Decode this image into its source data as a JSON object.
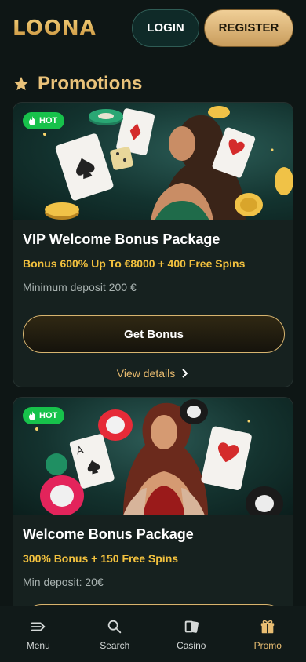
{
  "header": {
    "logo": "LOONA",
    "login_label": "LOGIN",
    "register_label": "REGISTER"
  },
  "section": {
    "icon": "star-icon",
    "title": "Promotions"
  },
  "promotions": [
    {
      "badge": "HOT",
      "title": "VIP Welcome Bonus Package",
      "subtitle": "Bonus 600% Up To €8000 + 400 Free Spins",
      "min_deposit": "Minimum deposit 200 €",
      "button_label": "Get Bonus",
      "details_label": "View details"
    },
    {
      "badge": "HOT",
      "title": "Welcome Bonus Package",
      "subtitle": "300% Bonus + 150 Free Spins",
      "min_deposit": "Min deposit: 20€"
    }
  ],
  "bottom_nav": [
    {
      "label": "Menu",
      "icon": "menu-arrow-icon"
    },
    {
      "label": "Search",
      "icon": "search-icon"
    },
    {
      "label": "Casino",
      "icon": "cards-icon"
    },
    {
      "label": "Promo",
      "icon": "gift-icon",
      "active": true
    }
  ],
  "colors": {
    "background": "#0e1615",
    "accent_gold": "#e9c27a",
    "promo_yellow": "#f2c13e",
    "hot_green": "#17c24b"
  }
}
